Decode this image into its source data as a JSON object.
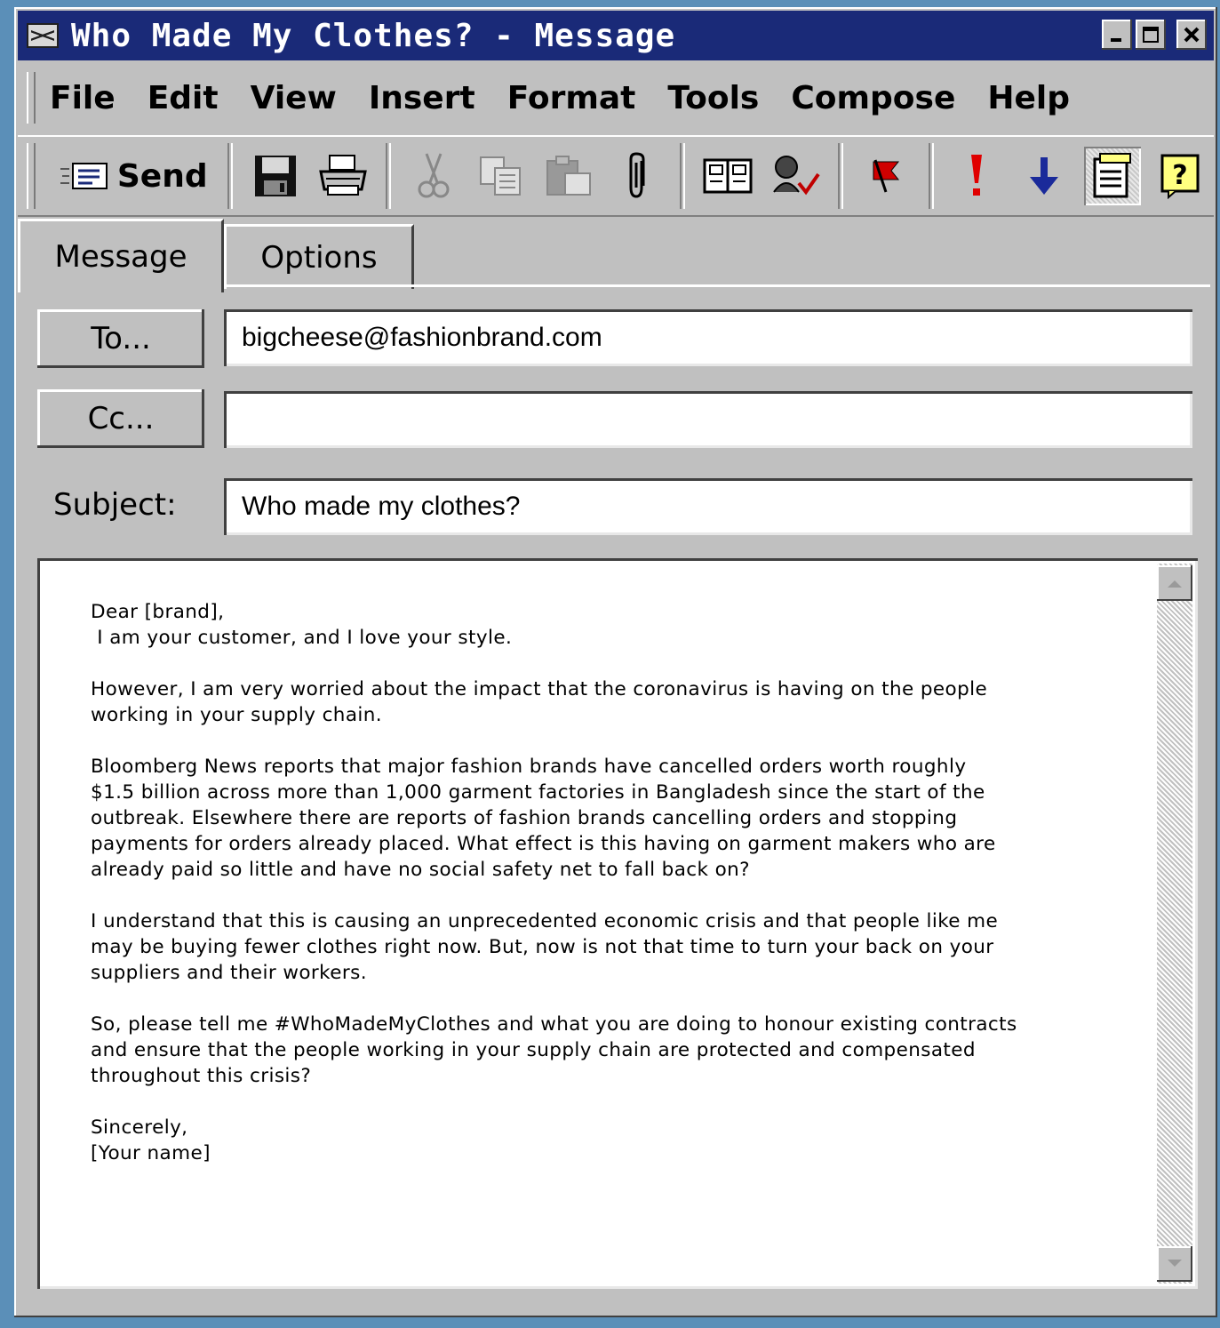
{
  "window": {
    "title": "Who Made My Clothes? - Message"
  },
  "menu": {
    "items": [
      {
        "label": "File"
      },
      {
        "label": "Edit"
      },
      {
        "label": "View"
      },
      {
        "label": "Insert"
      },
      {
        "label": "Format"
      },
      {
        "label": "Tools"
      },
      {
        "label": "Compose"
      },
      {
        "label": "Help"
      }
    ]
  },
  "toolbar": {
    "send_label": "Send",
    "buttons": [
      "save-icon",
      "print-icon",
      "cut-icon",
      "copy-icon",
      "paste-icon",
      "attach-icon",
      "address-book-icon",
      "check-names-icon",
      "flag-icon",
      "high-priority-icon",
      "low-priority-icon",
      "stationery-icon",
      "help-icon"
    ]
  },
  "tabs": {
    "message": "Message",
    "options": "Options"
  },
  "fields": {
    "to_button": "To...",
    "to_value": "bigcheese@fashionbrand.com",
    "cc_button": "Cc...",
    "cc_value": "",
    "subject_label": "Subject:",
    "subject_value": "Who made my clothes?"
  },
  "body": {
    "text": "Dear [brand],\n I am your customer, and I love your style.\n\nHowever, I am very worried about the impact that the coronavirus is having on the people\nworking in your supply chain.\n\nBloomberg News reports that major fashion brands have cancelled orders worth roughly\n$1.5 billion across more than 1,000 garment factories in Bangladesh since the start of the\noutbreak. Elsewhere there are reports of fashion brands cancelling orders and stopping\npayments for orders already placed. What effect is this having on garment makers who are\nalready paid so little and have no social safety net to fall back on?\n\nI understand that this is causing an unprecedented economic crisis and that people like me\nmay be buying fewer clothes right now. But, now is not that time to turn your back on your\nsuppliers and their workers.\n\nSo, please tell me #WhoMadeMyClothes and what you are doing to honour existing contracts\nand ensure that the people working in your supply chain are protected and compensated\nthroughout this crisis?\n\nSincerely,\n[Your name]"
  },
  "colors": {
    "titlebar": "#1a2a78",
    "chrome": "#c0c0c0",
    "high_priority": "#e00000",
    "low_priority": "#1a2a9a"
  }
}
